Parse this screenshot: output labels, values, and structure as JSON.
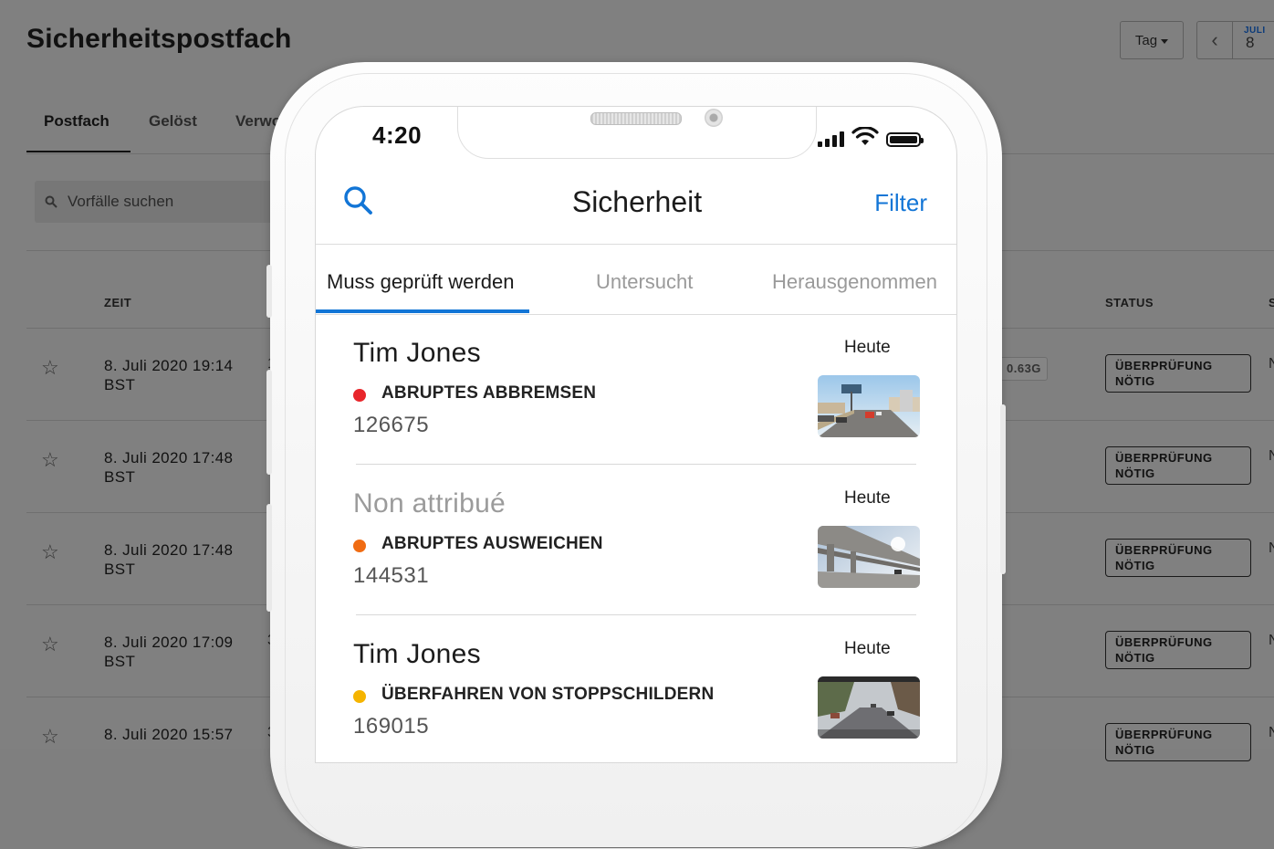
{
  "background": {
    "title": "Sicherheitspostfach",
    "range_selector": "Tag",
    "date": {
      "month": "JULI",
      "day": "8"
    },
    "tabs": [
      "Postfach",
      "Gelöst",
      "Verwo"
    ],
    "search_placeholder": "Vorfälle suchen",
    "columns": {
      "time": "ZEIT",
      "status": "STATUS",
      "edge": "S"
    },
    "g_value": "0.63G",
    "rows": [
      {
        "time_line1": "8. Juli 2020 19:14",
        "time_line2": "BST",
        "lead": "1",
        "status_line1": "ÜBERPRÜFUNG",
        "status_line2": "NÖTIG",
        "edge": "N"
      },
      {
        "time_line1": "8. Juli 2020 17:48",
        "time_line2": "BST",
        "lead": "",
        "status_line1": "ÜBERPRÜFUNG",
        "status_line2": "NÖTIG",
        "edge": "N"
      },
      {
        "time_line1": "8. Juli 2020 17:48",
        "time_line2": "BST",
        "lead": "",
        "status_line1": "ÜBERPRÜFUNG",
        "status_line2": "NÖTIG",
        "edge": "N"
      },
      {
        "time_line1": "8. Juli 2020 17:09",
        "time_line2": "BST",
        "lead": "3",
        "status_line1": "ÜBERPRÜFUNG",
        "status_line2": "NÖTIG",
        "edge": "N"
      },
      {
        "time_line1": "8. Juli 2020 15:57",
        "time_line2": "",
        "lead": "3",
        "status_line1": "ÜBERPRÜFUNG",
        "status_line2": "NÖTIG",
        "edge": "N"
      }
    ]
  },
  "phone": {
    "status_time": "4:20",
    "app_title": "Sicherheit",
    "filter_label": "Filter",
    "tabs": [
      "Muss geprüft werden",
      "Untersucht",
      "Herausgenommen"
    ],
    "items": [
      {
        "name": "Tim Jones",
        "when": "Heute",
        "event": "ABRUPTES ABBREMSEN",
        "number": "126675",
        "dot_color": "#e8262b"
      },
      {
        "name": "Non attribué",
        "when": "Heute",
        "event": "ABRUPTES AUSWEICHEN",
        "number": "144531",
        "dot_color": "#f06c13"
      },
      {
        "name": "Tim Jones",
        "when": "Heute",
        "event": "ÜBERFAHREN VON STOPPSCHILDERN",
        "number": "169015",
        "dot_color": "#f5b400"
      }
    ]
  },
  "colors": {
    "accent": "#1275d6",
    "overlay": "#808080"
  }
}
